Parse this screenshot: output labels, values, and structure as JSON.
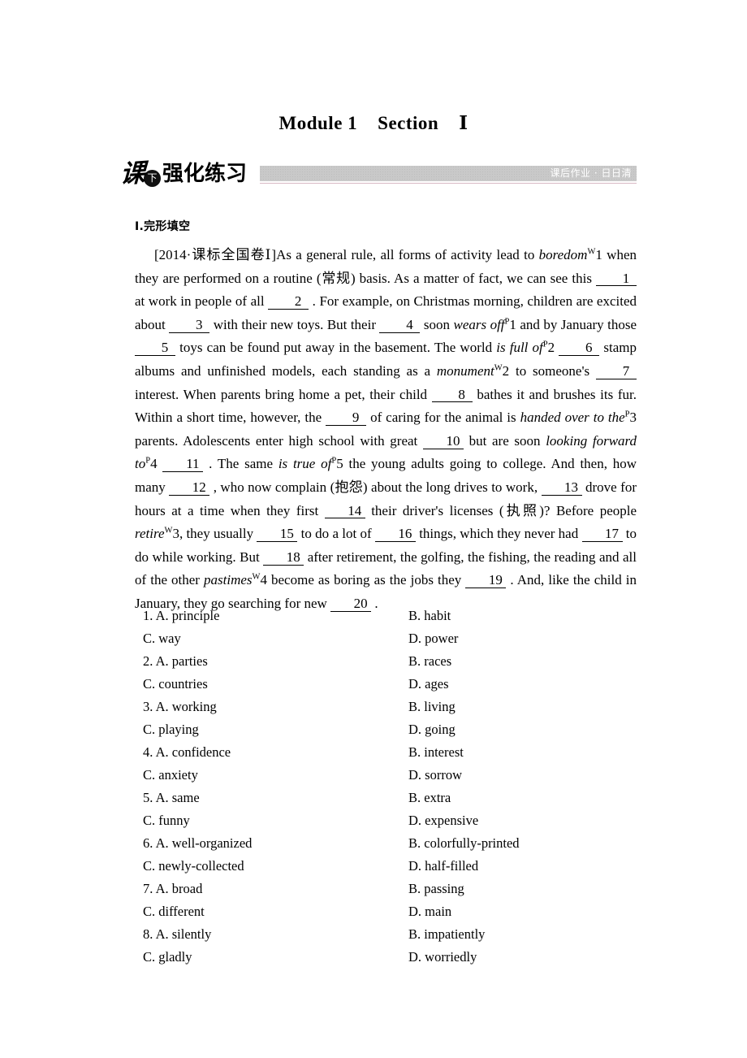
{
  "header": {
    "title": "Module 1    Section    Ⅰ",
    "logo": {
      "char_ke": "课",
      "char_xia": "下",
      "word": "强化练习"
    },
    "banner_label": "课后作业 · 日日清"
  },
  "section": {
    "heading": "Ⅰ.完形填空"
  },
  "passage": {
    "source_tag": "[2014·课标全国卷Ⅰ]",
    "segments": [
      {
        "type": "text",
        "value": "As a general rule, all forms of activity lead to "
      },
      {
        "type": "italic",
        "value": "boredom"
      },
      {
        "type": "sup",
        "value": "W"
      },
      {
        "type": "text",
        "value": "1 when they are performed on a routine (常规) basis. As a matter of fact, we can see this "
      },
      {
        "type": "blank",
        "value": "1"
      },
      {
        "type": "text",
        "value": " at work in people of all "
      },
      {
        "type": "blank",
        "value": "2"
      },
      {
        "type": "text",
        "value": ". For example, on Christmas morning, children are excited about "
      },
      {
        "type": "blank",
        "value": "3"
      },
      {
        "type": "text",
        "value": " with their new toys. But their "
      },
      {
        "type": "blank",
        "value": "4"
      },
      {
        "type": "text",
        "value": " soon "
      },
      {
        "type": "italic",
        "value": "wears off"
      },
      {
        "type": "sup",
        "value": "P"
      },
      {
        "type": "text",
        "value": "1 and by January those "
      },
      {
        "type": "blank",
        "value": "5"
      },
      {
        "type": "text",
        "value": " toys can be found put away in the basement. The world "
      },
      {
        "type": "italic",
        "value": "is full of"
      },
      {
        "type": "sup",
        "value": "P"
      },
      {
        "type": "text",
        "value": "2 "
      },
      {
        "type": "blank",
        "value": "6"
      },
      {
        "type": "text",
        "value": " stamp albums and unfinished models, each standing as a "
      },
      {
        "type": "italic",
        "value": "monument"
      },
      {
        "type": "sup",
        "value": "W"
      },
      {
        "type": "text",
        "value": "2 to someone's "
      },
      {
        "type": "blank",
        "value": "7"
      },
      {
        "type": "text",
        "value": " interest. When parents bring home a pet, their child "
      },
      {
        "type": "blank",
        "value": "8"
      },
      {
        "type": "text",
        "value": " bathes it and brushes its fur. Within a short time, however, the "
      },
      {
        "type": "blank",
        "value": "9"
      },
      {
        "type": "text",
        "value": " of caring for the animal is "
      },
      {
        "type": "italic",
        "value": "handed over to the"
      },
      {
        "type": "sup",
        "value": "P"
      },
      {
        "type": "text",
        "value": "3 parents. Adolescents enter high school with great "
      },
      {
        "type": "blank",
        "value": "10"
      },
      {
        "type": "text",
        "value": " but are soon "
      },
      {
        "type": "italic",
        "value": "looking forward to"
      },
      {
        "type": "sup",
        "value": "P"
      },
      {
        "type": "text",
        "value": "4 "
      },
      {
        "type": "blank",
        "value": "11"
      },
      {
        "type": "text",
        "value": ". The same "
      },
      {
        "type": "italic",
        "value": "is true of"
      },
      {
        "type": "sup",
        "value": "P"
      },
      {
        "type": "text",
        "value": "5 the young adults going to college. And then, how many "
      },
      {
        "type": "blank",
        "value": "12"
      },
      {
        "type": "text",
        "value": ",  who now complain (抱怨) about the long drives to work, "
      },
      {
        "type": "blank",
        "value": "13"
      },
      {
        "type": "text",
        "value": " drove for hours at a time when they first "
      },
      {
        "type": "blank",
        "value": "14"
      },
      {
        "type": "text",
        "value": " their driver's licenses (执照)? Before people "
      },
      {
        "type": "italic",
        "value": "retire"
      },
      {
        "type": "sup",
        "value": "W"
      },
      {
        "type": "text",
        "value": "3, they usually "
      },
      {
        "type": "blank",
        "value": "15"
      },
      {
        "type": "text",
        "value": " to do a lot of "
      },
      {
        "type": "blank",
        "value": "16"
      },
      {
        "type": "text",
        "value": " things, which they never had "
      },
      {
        "type": "blank",
        "value": "17"
      },
      {
        "type": "text",
        "value": " to do while working. But "
      },
      {
        "type": "blank",
        "value": "18"
      },
      {
        "type": "text",
        "value": " after retirement, the golfing, the fishing, the reading and all of the other "
      },
      {
        "type": "italic",
        "value": "pastimes"
      },
      {
        "type": "sup",
        "value": "W"
      },
      {
        "type": "text",
        "value": "4 become as boring as the jobs they "
      },
      {
        "type": "blank",
        "value": "19"
      },
      {
        "type": "text",
        "value": ". And, like the child in January, they go searching for new "
      },
      {
        "type": "blank",
        "value": "20"
      },
      {
        "type": "text",
        "value": "."
      }
    ]
  },
  "questions": [
    {
      "number": "1",
      "a": "A. principle",
      "b": "B. habit",
      "c": "C. way",
      "d": "D. power"
    },
    {
      "number": "2",
      "a": "A. parties",
      "b": "B. races",
      "c": "C. countries",
      "d": "D. ages"
    },
    {
      "number": "3",
      "a": "A. working",
      "b": "B. living",
      "c": "C. playing",
      "d": "D. going"
    },
    {
      "number": "4",
      "a": "A. confidence",
      "b": "B. interest",
      "c": "C. anxiety",
      "d": "D. sorrow"
    },
    {
      "number": "5",
      "a": "A. same",
      "b": "B. extra",
      "c": "C. funny",
      "d": "D. expensive"
    },
    {
      "number": "6",
      "a": "A. well-organized",
      "b": "B. colorfully-printed",
      "c": "C. newly-collected",
      "d": "D. half-filled"
    },
    {
      "number": "7",
      "a": "A. broad",
      "b": "B. passing",
      "c": "C. different",
      "d": "D. main"
    },
    {
      "number": "8",
      "a": "A. silently",
      "b": "B. impatiently",
      "c": "C. gladly",
      "d": "D. worriedly"
    }
  ]
}
